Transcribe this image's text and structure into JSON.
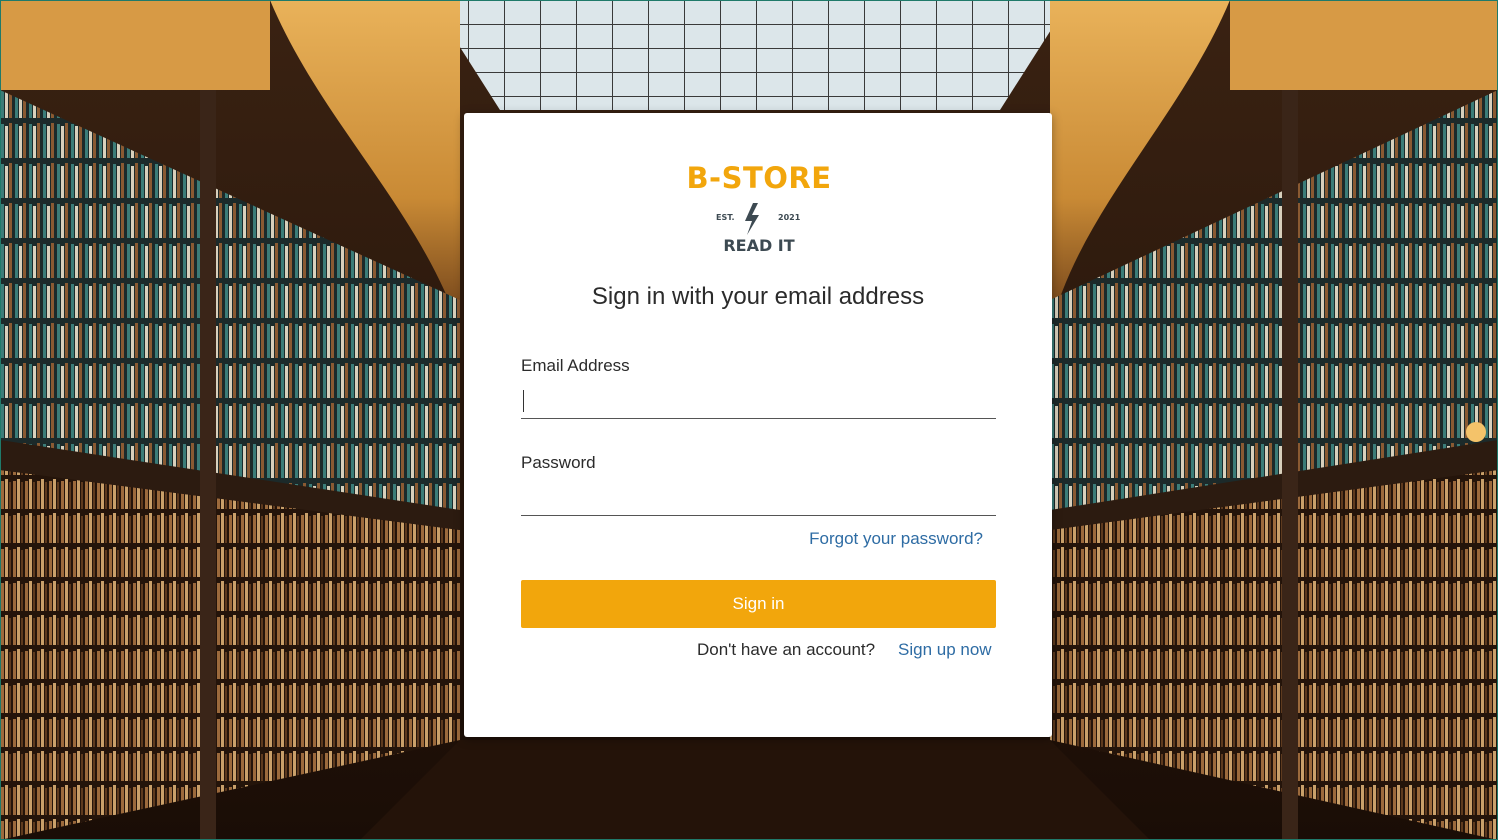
{
  "brand": {
    "name": "B-STORE",
    "est": "EST.",
    "year": "2021",
    "tagline": "READ IT",
    "color": "#f2a60c"
  },
  "form": {
    "title": "Sign in with your email address",
    "email_label": "Email Address",
    "email_value": "",
    "password_label": "Password",
    "password_value": "",
    "forgot_link": "Forgot your password?",
    "submit_label": "Sign in",
    "no_account_text": "Don't have an account?",
    "signup_link": "Sign up now"
  },
  "colors": {
    "accent": "#f2a60c",
    "link": "#2e6ca4",
    "card": "#ffffff"
  },
  "background": {
    "image": "library-interior"
  }
}
